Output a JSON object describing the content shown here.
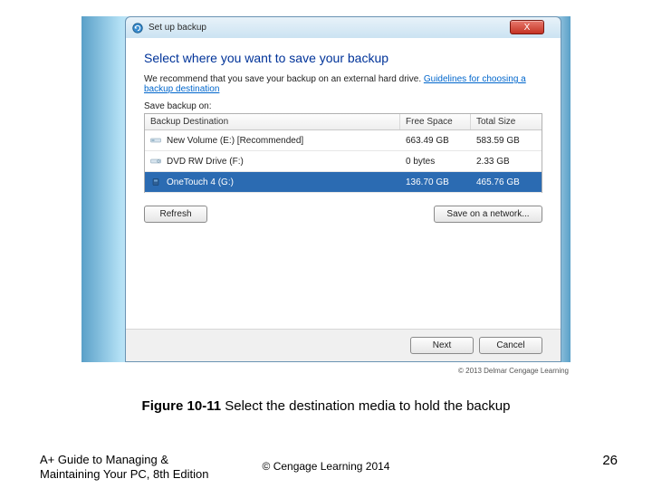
{
  "window": {
    "title": "Set up backup",
    "close_glyph": "X"
  },
  "dialog": {
    "heading": "Select where you want to save your backup",
    "recommend_pre": "We recommend that you save your backup on an external hard drive. ",
    "recommend_link": "Guidelines for choosing a backup destination",
    "save_label": "Save backup on:",
    "columns": {
      "dest": "Backup Destination",
      "free": "Free Space",
      "total": "Total Size"
    },
    "rows": [
      {
        "name": "New Volume (E:) [Recommended]",
        "free": "663.49 GB",
        "total": "583.59 GB",
        "selected": false,
        "icon": "hdd"
      },
      {
        "name": "DVD RW Drive (F:)",
        "free": "0 bytes",
        "total": "2.33 GB",
        "selected": false,
        "icon": "dvd"
      },
      {
        "name": "OneTouch 4 (G:)",
        "free": "136.70 GB",
        "total": "465.76 GB",
        "selected": true,
        "icon": "ext"
      }
    ],
    "refresh": "Refresh",
    "save_net": "Save on a network...",
    "next": "Next",
    "cancel": "Cancel"
  },
  "credit": "© 2013 Delmar Cengage Learning",
  "caption_bold": "Figure 10-11",
  "caption_rest": "  Select the destination media to hold the backup",
  "book_line1": "A+ Guide to Managing &",
  "book_line2": "Maintaining Your PC, 8th Edition",
  "copyright": "© Cengage Learning  2014",
  "pagenum": "26"
}
